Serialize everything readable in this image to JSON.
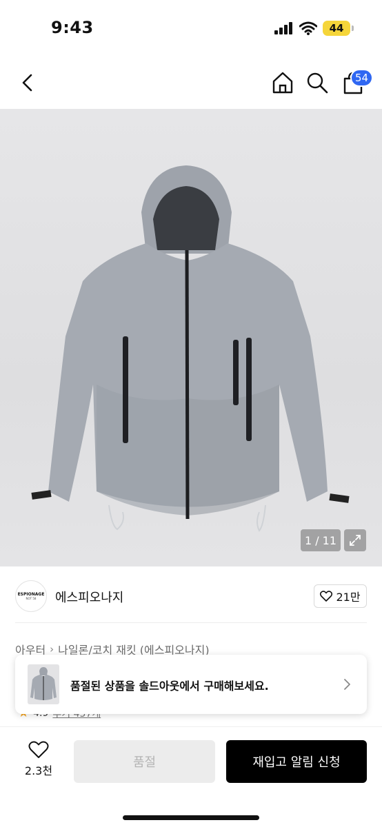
{
  "status_bar": {
    "time": "9:43",
    "battery": "44"
  },
  "nav": {
    "cart_count": "54"
  },
  "product": {
    "image_counter": "1 / 11"
  },
  "brand": {
    "logo_text": "ESPIONAGE",
    "logo_sub": "NOT 58",
    "name": "에스피오나지",
    "likes": "21만"
  },
  "breadcrumb": {
    "category": "아우터",
    "subcategory": "나일론/코치 재킷 (에스피오나지)"
  },
  "rating": {
    "score": "4.9",
    "count": "후기 457개"
  },
  "soldout_banner": {
    "text": "품절된 상품을 솔드아웃에서 구매해보세요."
  },
  "bottom": {
    "wish_count": "2.3천",
    "soldout_label": "품절",
    "restock_label": "재입고 알림 신청"
  },
  "colors": {
    "accent": "#2f67f2",
    "battery": "#f5d53a",
    "cta": "#000000"
  }
}
